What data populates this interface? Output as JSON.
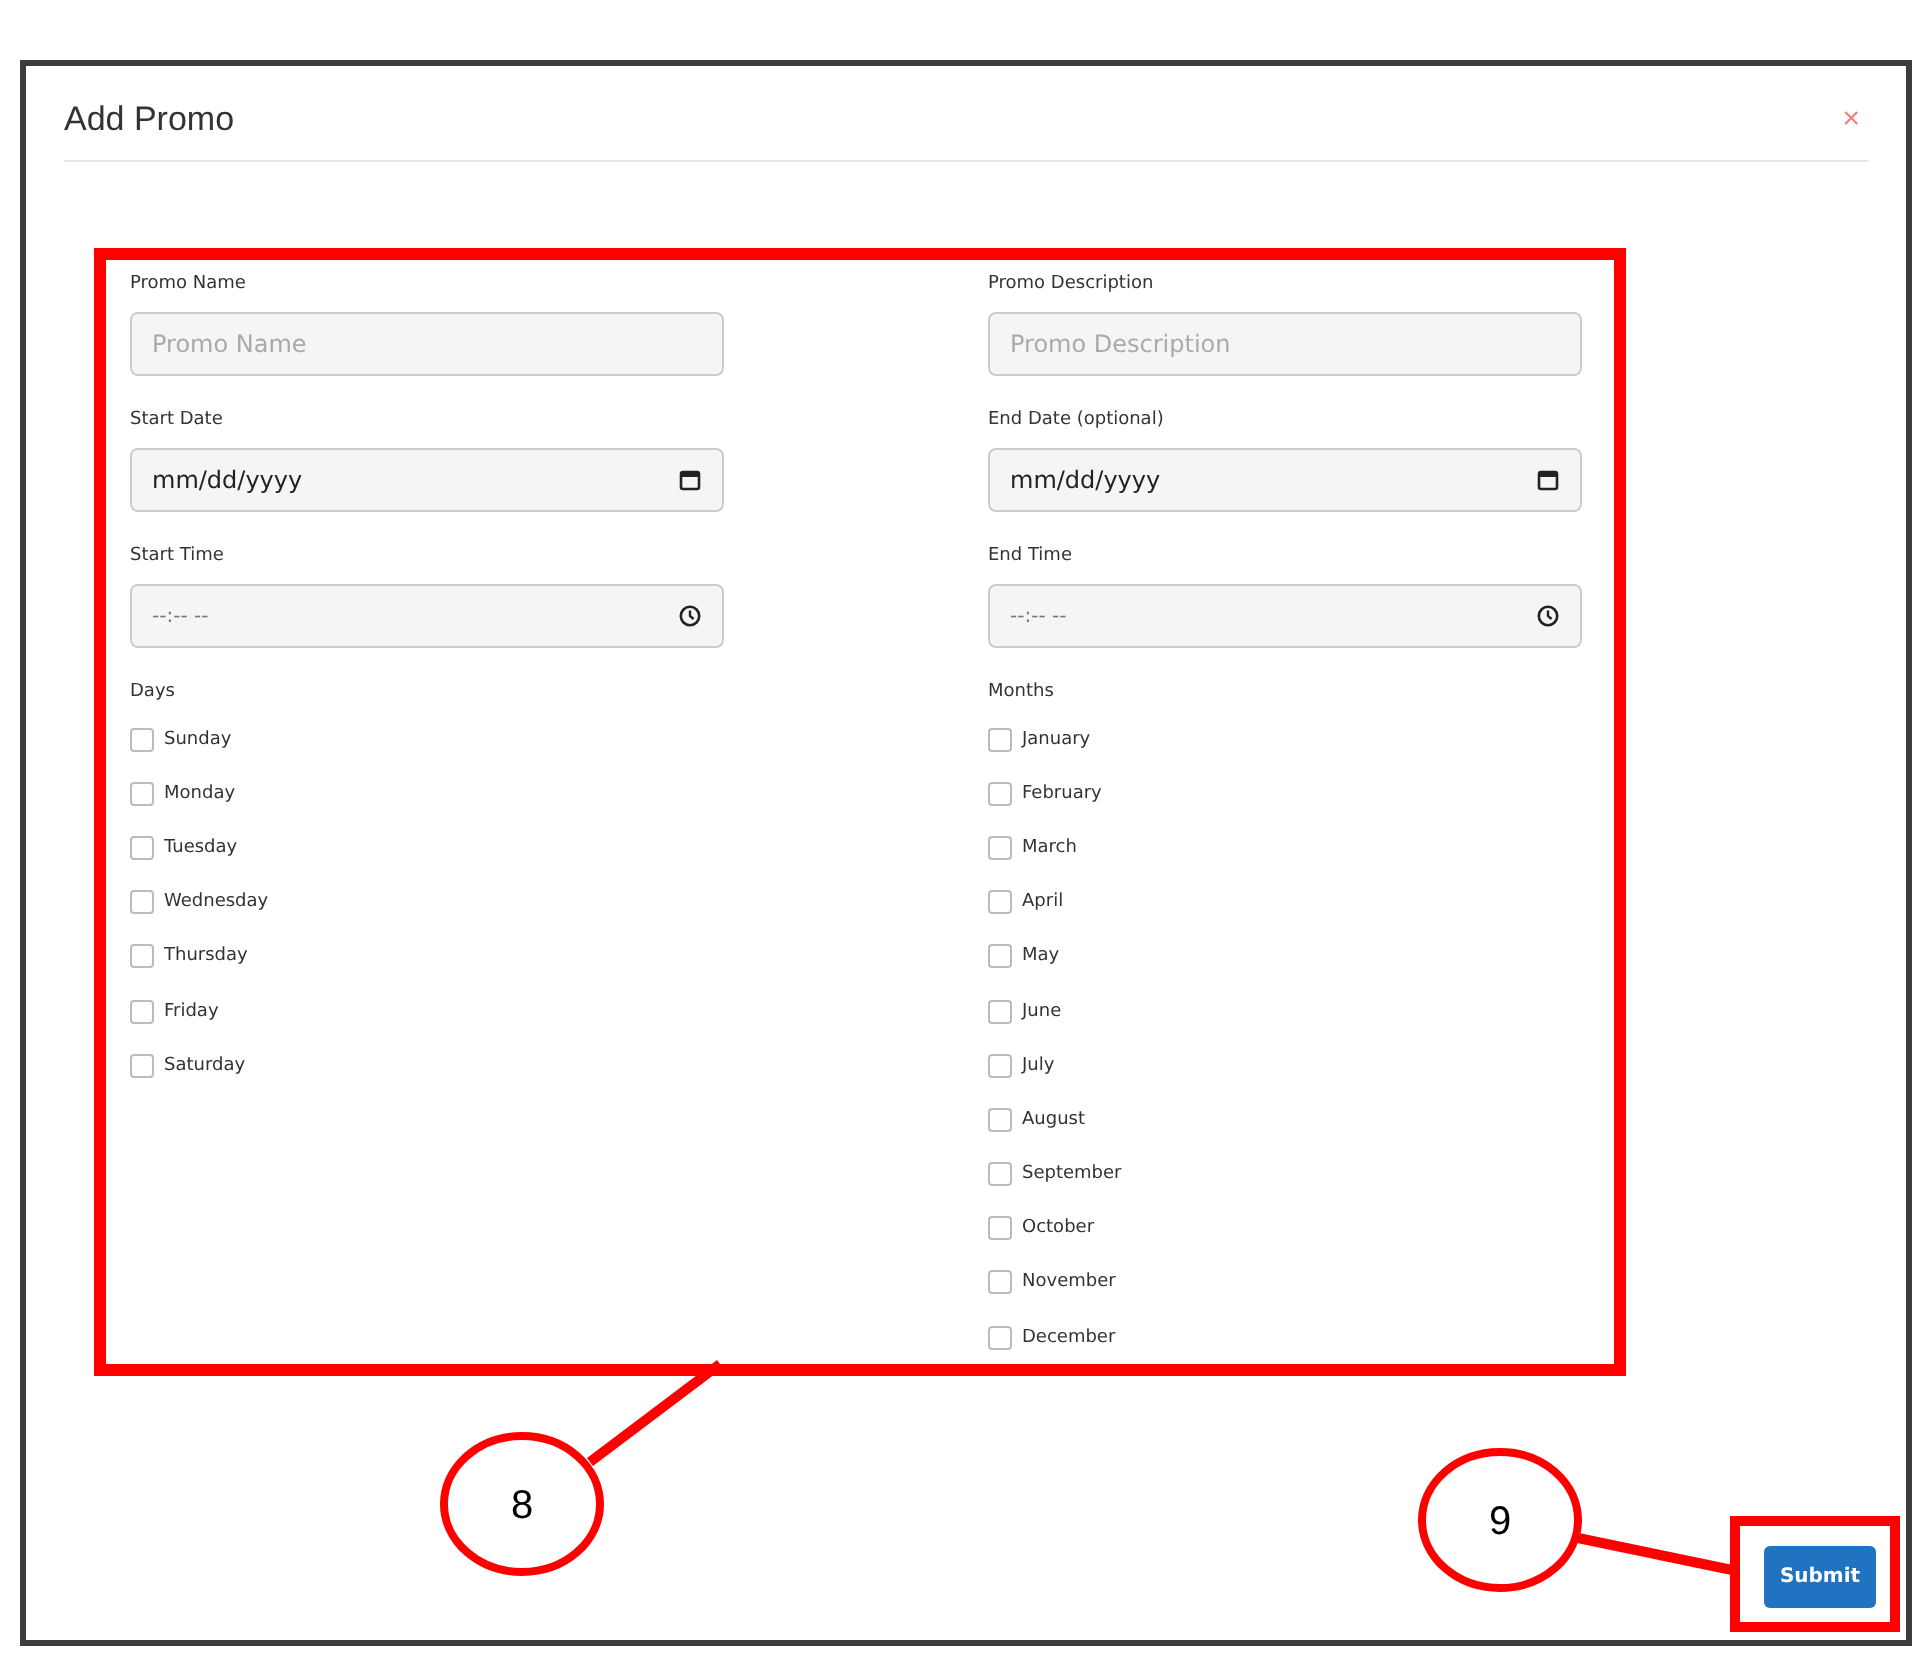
{
  "dialog": {
    "title": "Add Promo",
    "close": "×"
  },
  "fields": [
    {
      "label": "Promo Name",
      "kind": "text",
      "placeholder": "Promo Name"
    },
    {
      "label": "Promo Description",
      "kind": "text",
      "placeholder": "Promo Description"
    },
    {
      "label": "Start Date",
      "kind": "date",
      "value": "mm/dd/yyyy"
    },
    {
      "label": "End Date (optional)",
      "kind": "date",
      "value": "mm/dd/yyyy"
    },
    {
      "label": "Start Time",
      "kind": "time",
      "value": "--:-- --"
    },
    {
      "label": "End Time",
      "kind": "time",
      "value": "--:-- --"
    }
  ],
  "days": {
    "label": "Days",
    "options": [
      {
        "label": "Sunday",
        "checked": false
      },
      {
        "label": "Monday",
        "checked": false
      },
      {
        "label": "Tuesday",
        "checked": false
      },
      {
        "label": "Wednesday",
        "checked": false
      },
      {
        "label": "Thursday",
        "checked": false
      },
      {
        "label": "Friday",
        "checked": false
      },
      {
        "label": "Saturday",
        "checked": false
      }
    ]
  },
  "months": {
    "label": "Months",
    "options": [
      {
        "label": "January",
        "checked": false
      },
      {
        "label": "February",
        "checked": false
      },
      {
        "label": "March",
        "checked": false
      },
      {
        "label": "April",
        "checked": false
      },
      {
        "label": "May",
        "checked": false
      },
      {
        "label": "June",
        "checked": false
      },
      {
        "label": "July",
        "checked": false
      },
      {
        "label": "August",
        "checked": false
      },
      {
        "label": "September",
        "checked": false
      },
      {
        "label": "October",
        "checked": false
      },
      {
        "label": "November",
        "checked": false
      },
      {
        "label": "December",
        "checked": false
      }
    ]
  },
  "submit": "Submit",
  "callouts": [
    "8",
    "9"
  ]
}
